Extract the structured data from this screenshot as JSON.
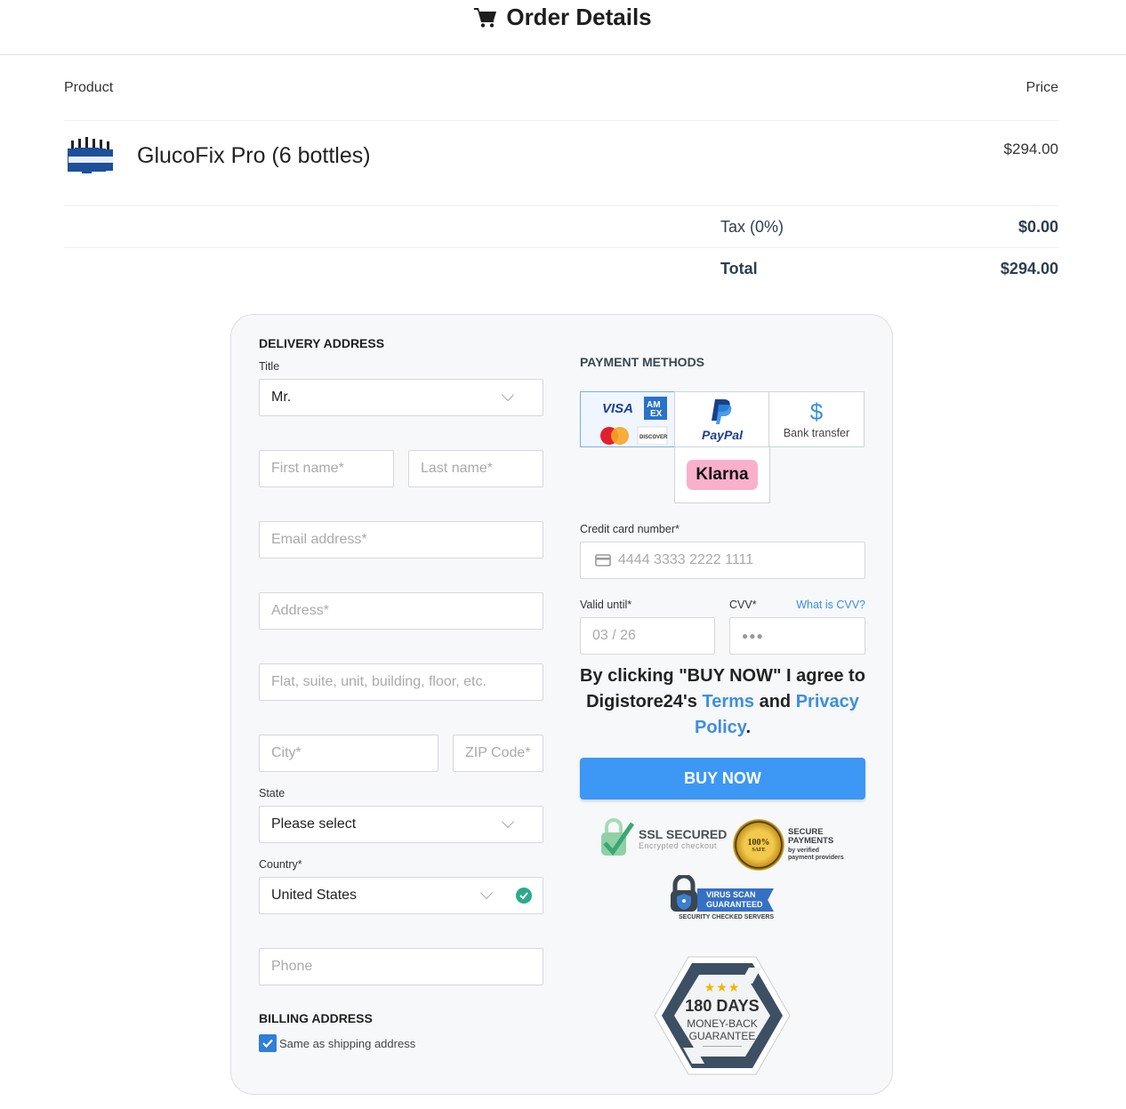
{
  "header": {
    "title": "Order Details",
    "icon": "shopping-cart-icon"
  },
  "order": {
    "columns": {
      "product": "Product",
      "price": "Price"
    },
    "items": [
      {
        "name": "GlucoFix Pro (6 bottles)",
        "price": "$294.00",
        "image": "product-bottles-image"
      }
    ],
    "tax": {
      "label": "Tax (0%)",
      "value": "$0.00"
    },
    "total": {
      "label": "Total",
      "value": "$294.00"
    }
  },
  "delivery": {
    "heading": "DELIVERY ADDRESS",
    "title_label": "Title",
    "title_value": "Mr.",
    "first_name_placeholder": "First name*",
    "last_name_placeholder": "Last name*",
    "email_placeholder": "Email address*",
    "address_placeholder": "Address*",
    "address2_placeholder": "Flat, suite, unit, building, floor, etc.",
    "city_placeholder": "City*",
    "zip_placeholder": "ZIP Code*",
    "state_label": "State",
    "state_value": "Please select",
    "country_label": "Country*",
    "country_value": "United States",
    "phone_placeholder": "Phone"
  },
  "billing": {
    "heading": "BILLING ADDRESS",
    "same_label": "Same as shipping address",
    "same_checked": true
  },
  "payment": {
    "heading": "PAYMENT METHODS",
    "methods": [
      {
        "name": "Credit cards",
        "brands": [
          "VISA",
          "AMEX",
          "Mastercard",
          "DISCOVER"
        ],
        "selected": true
      },
      {
        "name": "PayPal",
        "label": "PayPal",
        "selected": false
      },
      {
        "name": "Bank transfer",
        "label": "Bank transfer",
        "icon": "$",
        "selected": false
      },
      {
        "name": "Klarna",
        "label": "Klarna",
        "selected": false
      }
    ],
    "card_label": "Credit card number*",
    "card_placeholder": "4444 3333 2222 1111",
    "valid_label": "Valid until*",
    "valid_placeholder": "03 / 26",
    "cvv_label": "CVV*",
    "cvv_help": "What is CVV?",
    "cvv_placeholder": "●●●",
    "legal": {
      "pre": "By clicking \"BUY NOW\" I agree to Digistore24's ",
      "terms": "Terms",
      "mid": " and ",
      "privacy": "Privacy Policy",
      "post": "."
    },
    "buy_label": "BUY NOW"
  },
  "badges": {
    "ssl": {
      "title": "SSL SECURED",
      "sub": "Encrypted checkout"
    },
    "secure": {
      "seal": "100%",
      "seal_sub": "SAFE",
      "title1": "SECURE",
      "title2": "PAYMENTS",
      "sub1": "by verified",
      "sub2": "payment providers"
    },
    "virus": {
      "line1": "VIRUS SCAN",
      "line2": "GUARANTEED",
      "sub": "SECURITY CHECKED SERVERS"
    },
    "guarantee": {
      "stars": "★★★",
      "days": "180 DAYS",
      "line1": "MONEY-BACK",
      "line2": "GUARANTEE"
    }
  },
  "colors": {
    "accent": "#3d97f5",
    "link": "#3e8ee0",
    "success": "#2bab8b",
    "text_dark": "#2c3e50"
  }
}
